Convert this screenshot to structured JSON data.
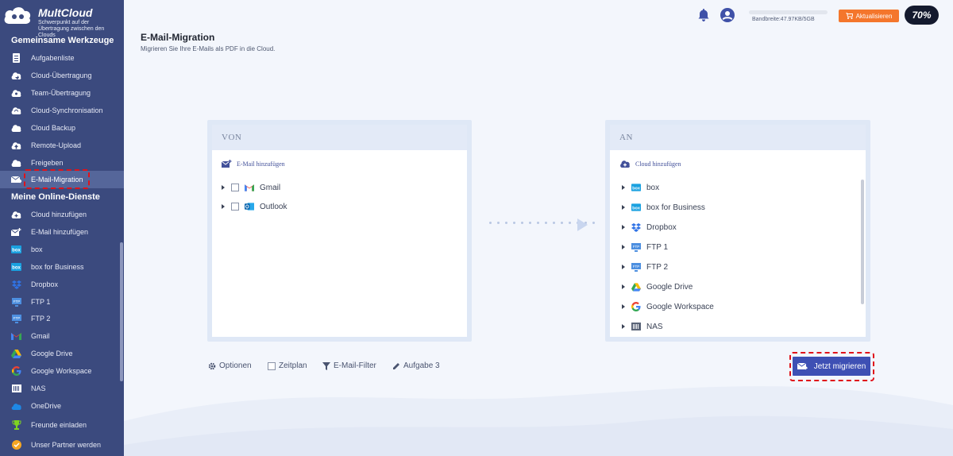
{
  "app": {
    "name": "MultCloud",
    "tagline": "Schwerpunkt auf der Übertragung zwischen den Clouds"
  },
  "sidebar": {
    "section1_title": "Gemeinsame Werkzeuge",
    "tools": [
      {
        "label": "Aufgabenliste",
        "icon": "task-list-icon"
      },
      {
        "label": "Cloud-Übertragung",
        "icon": "cloud-transfer-icon"
      },
      {
        "label": "Team-Übertragung",
        "icon": "team-transfer-icon"
      },
      {
        "label": "Cloud-Synchronisation",
        "icon": "cloud-sync-icon"
      },
      {
        "label": "Cloud Backup",
        "icon": "cloud-backup-icon"
      },
      {
        "label": "Remote-Upload",
        "icon": "remote-upload-icon"
      },
      {
        "label": "Freigeben",
        "icon": "share-icon"
      },
      {
        "label": "E-Mail-Migration",
        "icon": "email-migration-icon",
        "active": true
      }
    ],
    "section2_title": "Meine Online-Dienste",
    "services": [
      {
        "label": "Cloud hinzufügen",
        "icon": "add-cloud-icon"
      },
      {
        "label": "E-Mail hinzufügen",
        "icon": "add-email-icon"
      },
      {
        "label": "box",
        "icon": "box-icon"
      },
      {
        "label": "box for Business",
        "icon": "box-business-icon"
      },
      {
        "label": "Dropbox",
        "icon": "dropbox-icon"
      },
      {
        "label": "FTP 1",
        "icon": "ftp-icon"
      },
      {
        "label": "FTP 2",
        "icon": "ftp-icon"
      },
      {
        "label": "Gmail",
        "icon": "gmail-icon"
      },
      {
        "label": "Google Drive",
        "icon": "google-drive-icon"
      },
      {
        "label": "Google Workspace",
        "icon": "google-workspace-icon"
      },
      {
        "label": "NAS",
        "icon": "nas-icon"
      },
      {
        "label": "OneDrive",
        "icon": "onedrive-icon"
      }
    ],
    "footer": [
      {
        "label": "Freunde einladen",
        "icon": "trophy-icon"
      },
      {
        "label": "Unser Partner werden",
        "icon": "partner-icon"
      }
    ]
  },
  "header": {
    "bandwidth": "Bandbreite:47.97KB/5GB",
    "bandwidth_used_fraction": 1e-05,
    "upgrade_label": "Aktualisieren",
    "promo_label": "70%"
  },
  "page": {
    "title": "E-Mail-Migration",
    "subtitle": "Migrieren Sie Ihre E-Mails als PDF in die Cloud."
  },
  "from_panel": {
    "title": "VON",
    "add_label": "E-Mail hinzufügen",
    "items": [
      {
        "label": "Gmail",
        "icon": "gmail-icon"
      },
      {
        "label": "Outlook",
        "icon": "outlook-icon"
      }
    ]
  },
  "to_panel": {
    "title": "AN",
    "add_label": "Cloud hinzufügen",
    "items": [
      {
        "label": "box",
        "icon": "box-icon"
      },
      {
        "label": "box for Business",
        "icon": "box-business-icon"
      },
      {
        "label": "Dropbox",
        "icon": "dropbox-icon"
      },
      {
        "label": "FTP 1",
        "icon": "ftp-icon"
      },
      {
        "label": "FTP 2",
        "icon": "ftp-icon"
      },
      {
        "label": "Google Drive",
        "icon": "google-drive-icon"
      },
      {
        "label": "Google Workspace",
        "icon": "google-workspace-icon"
      },
      {
        "label": "NAS",
        "icon": "nas-icon"
      }
    ]
  },
  "toolbar": {
    "options_label": "Optionen",
    "schedule_label": "Zeitplan",
    "filter_label": "E-Mail-Filter",
    "task_label": "Aufgabe 3",
    "migrate_label": "Jetzt migrieren"
  },
  "colors": {
    "sidebar_bg": "#3b4a7e",
    "accent": "#3e50b4",
    "upgrade": "#f4762c",
    "highlight": "#e0121a"
  }
}
